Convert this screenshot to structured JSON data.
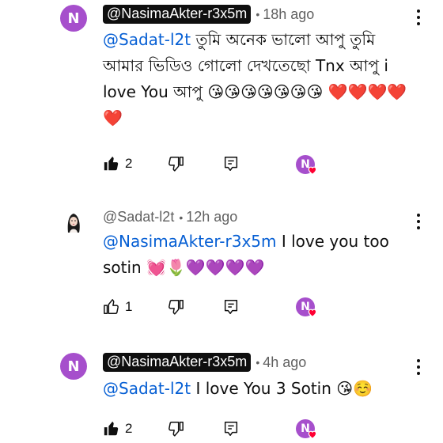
{
  "comments": [
    {
      "avatar_letter": "N",
      "handle": "@NasimaAkter-r3x5m",
      "handle_style": "creator-chip",
      "time": "18h ago",
      "mention": "@Sadat-l2t",
      "text": " তুমি অনেক ভালো আপু তুমি আমার ভিডিও গোলো দেখতেছো Tnx আপু i love You আপু 😘😘😘😘😘😘😘 ❤️❤️❤️❤️❤️",
      "likes": "2",
      "liked": true,
      "heart_avatar_letter": "N"
    },
    {
      "avatar_letter": "",
      "handle": "@Sadat-l2t",
      "handle_style": "plain",
      "time": "12h ago",
      "mention": "@NasimaAkter-r3x5m",
      "text": " I love you too sotin 💓🌷💜💜💜💜",
      "likes": "1",
      "liked": false,
      "heart_avatar_letter": "N"
    },
    {
      "avatar_letter": "N",
      "handle": "@NasimaAkter-r3x5m",
      "handle_style": "creator-chip",
      "time": "4h ago",
      "mention": "@Sadat-l2t",
      "text": "  I love You 3 Sotin 😘☺️",
      "likes": "2",
      "liked": true,
      "heart_avatar_letter": "N"
    }
  ],
  "colors": {
    "mention": "#065fd4",
    "avatar": "#a64fcc",
    "heart": "#ff0033"
  },
  "icons": [
    "thumbs-up-icon",
    "thumbs-down-icon",
    "reply-icon",
    "more-vert-icon",
    "heart-icon"
  ]
}
